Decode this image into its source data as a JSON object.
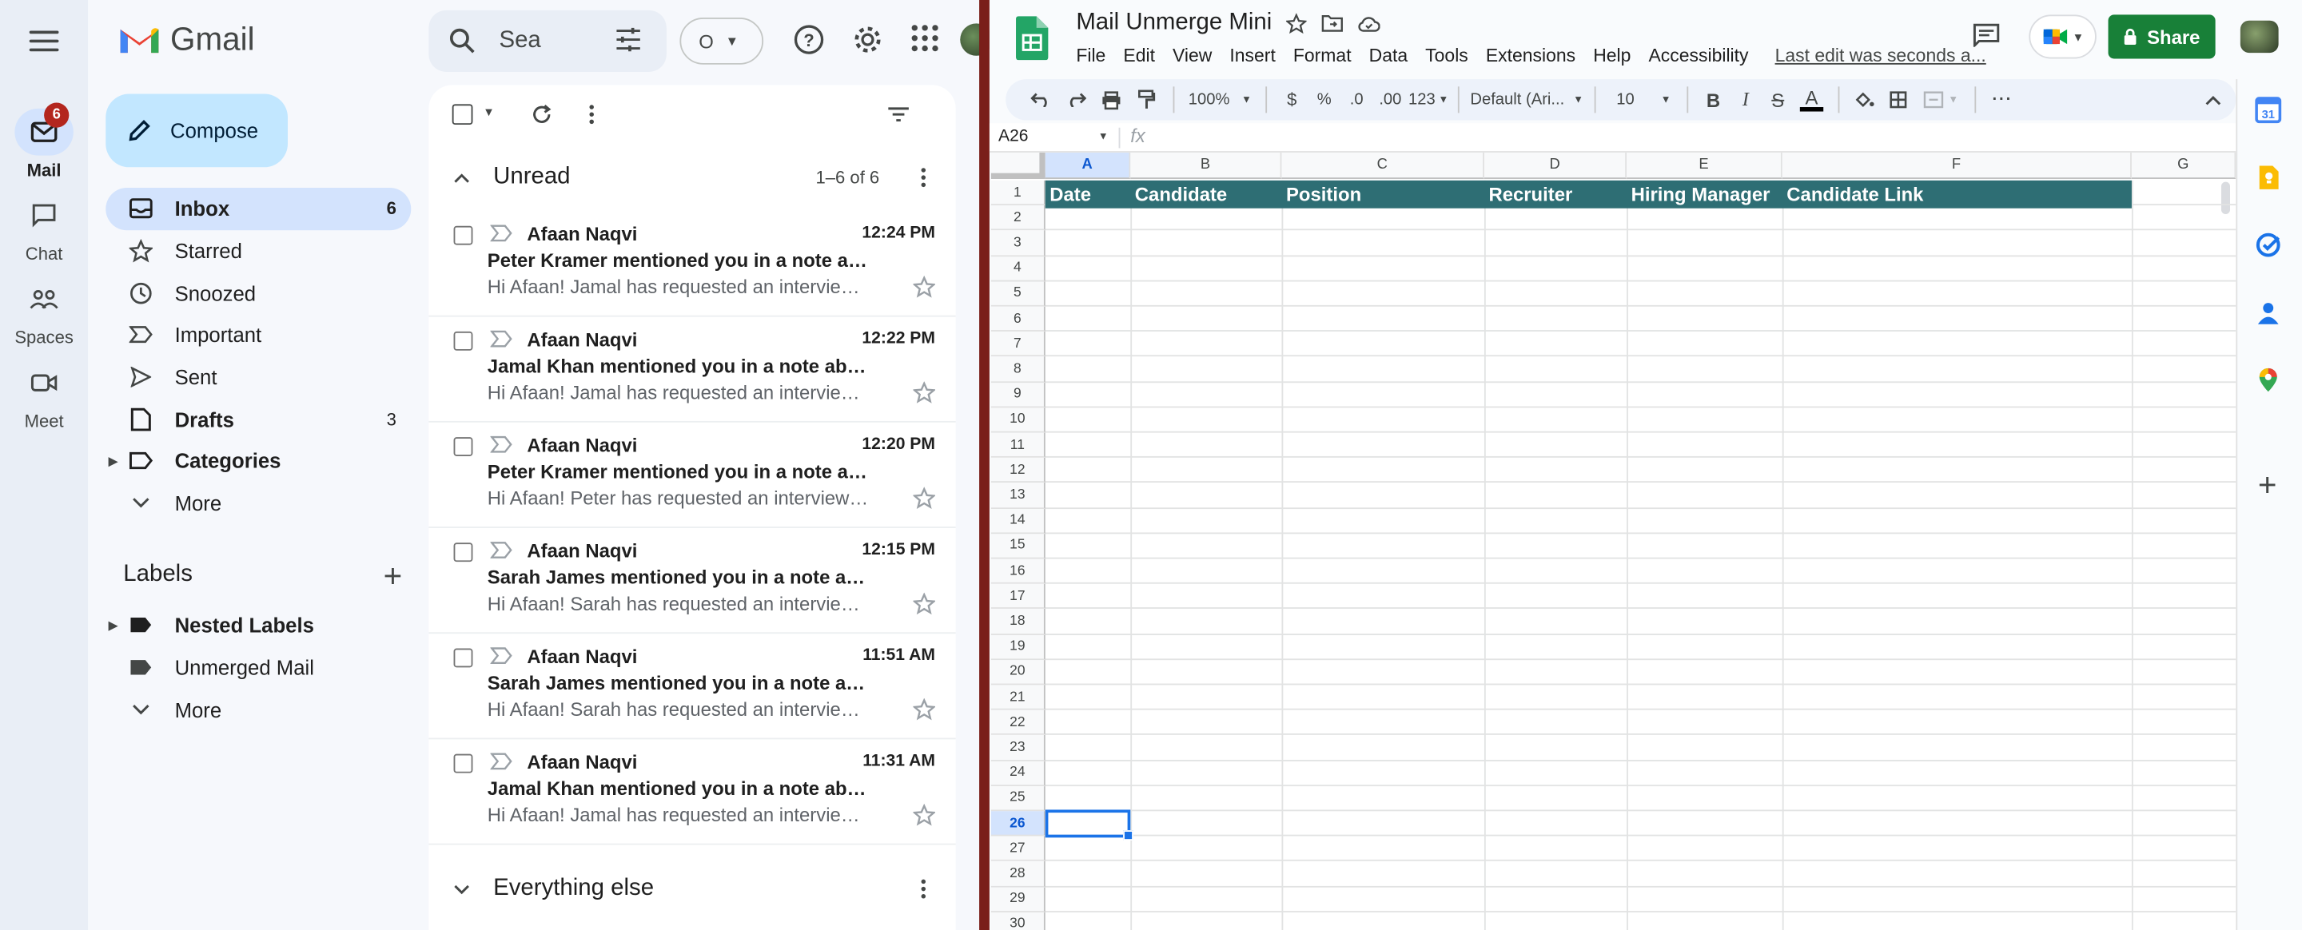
{
  "gmail": {
    "rail": {
      "mail_label": "Mail",
      "mail_badge": "6",
      "chat_label": "Chat",
      "spaces_label": "Spaces",
      "meet_label": "Meet"
    },
    "logo_text": "Gmail",
    "compose_label": "Compose",
    "nav": [
      {
        "label": "Inbox",
        "count": "6",
        "icon": "inbox-icon"
      },
      {
        "label": "Starred",
        "count": "",
        "icon": "star-icon"
      },
      {
        "label": "Snoozed",
        "count": "",
        "icon": "clock-icon"
      },
      {
        "label": "Important",
        "count": "",
        "icon": "important-icon"
      },
      {
        "label": "Sent",
        "count": "",
        "icon": "send-icon"
      },
      {
        "label": "Drafts",
        "count": "3",
        "icon": "draft-icon"
      },
      {
        "label": "Categories",
        "count": "",
        "icon": "label-icon"
      },
      {
        "label": "More",
        "count": "",
        "icon": "chevron-down-icon"
      }
    ],
    "labels_title": "Labels",
    "labels": [
      {
        "label": "Nested Labels"
      },
      {
        "label": "Unmerged Mail"
      },
      {
        "label": "More"
      }
    ],
    "search_placeholder": "Sea",
    "status_letter": "O",
    "unread_title": "Unread",
    "unread_range": "1–6 of 6",
    "everything_else_title": "Everything else",
    "emails": [
      {
        "sender": "Afaan Naqvi",
        "time": "12:24 PM",
        "subject": "Peter Kramer mentioned you in a note ab...",
        "snippet": "Hi Afaan! Jamal has requested an interview ..."
      },
      {
        "sender": "Afaan Naqvi",
        "time": "12:22 PM",
        "subject": "Jamal Khan mentioned you in a note abo...",
        "snippet": "Hi Afaan! Jamal has requested an interview ..."
      },
      {
        "sender": "Afaan Naqvi",
        "time": "12:20 PM",
        "subject": "Peter Kramer mentioned you in a note ab...",
        "snippet": "Hi Afaan! Peter has requested an interview w..."
      },
      {
        "sender": "Afaan Naqvi",
        "time": "12:15 PM",
        "subject": "Sarah James mentioned you in a note ab...",
        "snippet": "Hi Afaan! Sarah has requested an interview ..."
      },
      {
        "sender": "Afaan Naqvi",
        "time": "11:51 AM",
        "subject": "Sarah James mentioned you in a note ab...",
        "snippet": "Hi Afaan! Sarah has requested an interview ..."
      },
      {
        "sender": "Afaan Naqvi",
        "time": "11:31 AM",
        "subject": "Jamal Khan mentioned you in a note abo...",
        "snippet": "Hi Afaan! Jamal has requested an interview ..."
      }
    ]
  },
  "sheets": {
    "title": "Mail Unmerge Mini",
    "menus": [
      "File",
      "Edit",
      "View",
      "Insert",
      "Format",
      "Data",
      "Tools",
      "Extensions",
      "Help",
      "Accessibility"
    ],
    "last_edit": "Last edit was seconds a...",
    "share_label": "Share",
    "toolbar": {
      "zoom": "100%",
      "currency": "$",
      "percent": "%",
      "dec_decrease": ".0",
      "dec_increase": ".00",
      "number_format": "123",
      "font": "Default (Ari...",
      "font_size": "10"
    },
    "name_box": "A26",
    "formula_symbol": "fx",
    "columns": [
      "A",
      "B",
      "C",
      "D",
      "E",
      "F",
      "G"
    ],
    "rows": [
      "1",
      "2",
      "3",
      "4",
      "5",
      "6",
      "7",
      "8",
      "9",
      "10",
      "11",
      "12",
      "13",
      "14",
      "15",
      "16",
      "17",
      "18",
      "19",
      "20",
      "21",
      "22",
      "23",
      "24",
      "25",
      "26",
      "27",
      "28",
      "29",
      "30"
    ],
    "selected_row": "26",
    "header_cells": [
      "Date",
      "Candidate",
      "Position",
      "Recruiter",
      "Hiring Manager",
      "Candidate Link"
    ]
  },
  "colors": {
    "sheet_header_bg": "#2e6e74",
    "share_green": "#188038",
    "inbox_active": "#d3e3fd",
    "compose_bg": "#c2e7ff"
  }
}
